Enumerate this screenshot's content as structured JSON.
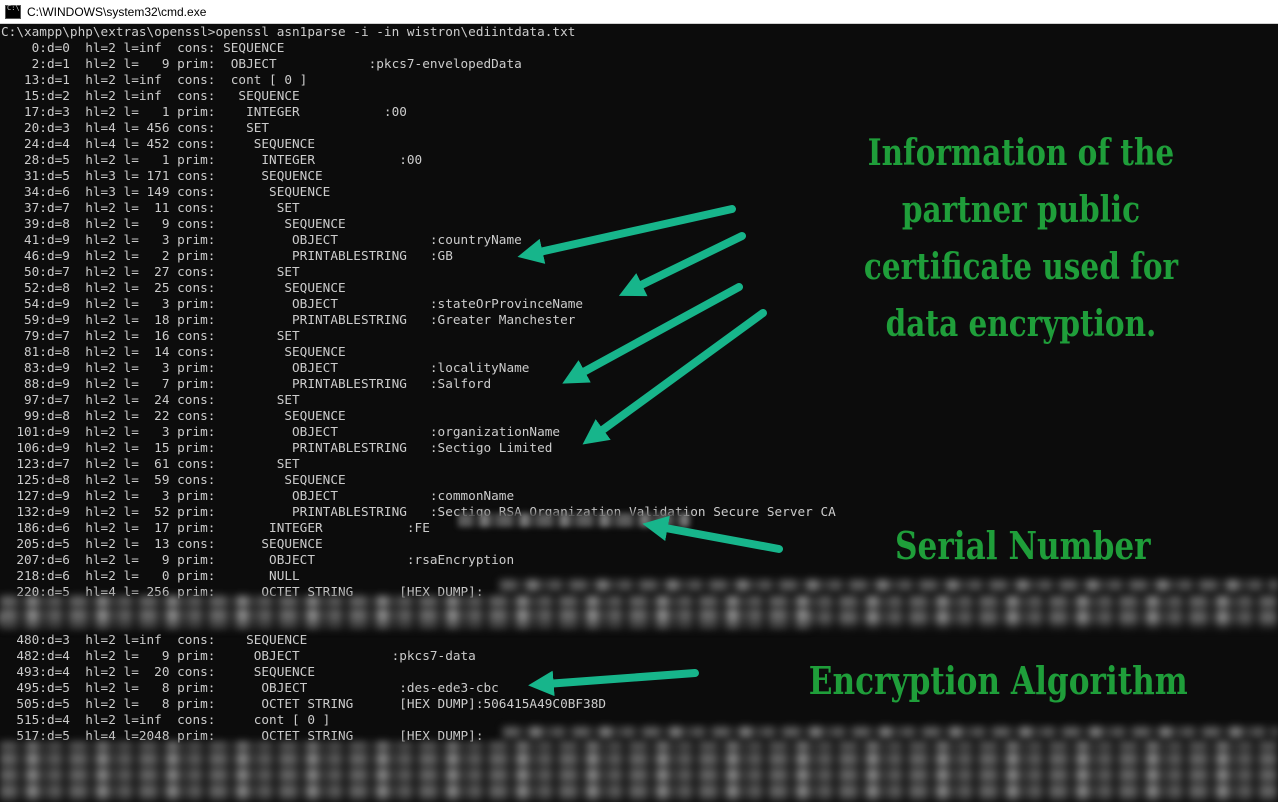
{
  "window": {
    "title": "C:\\WINDOWS\\system32\\cmd.exe",
    "icon": "console-icon"
  },
  "console": {
    "lines": [
      "C:\\xampp\\php\\extras\\openssl>openssl asn1parse -i -in wistron\\ediintdata.txt",
      "    0:d=0  hl=2 l=inf  cons: SEQUENCE",
      "    2:d=1  hl=2 l=   9 prim:  OBJECT            :pkcs7-envelopedData",
      "   13:d=1  hl=2 l=inf  cons:  cont [ 0 ]",
      "   15:d=2  hl=2 l=inf  cons:   SEQUENCE",
      "   17:d=3  hl=2 l=   1 prim:    INTEGER           :00",
      "   20:d=3  hl=4 l= 456 cons:    SET",
      "   24:d=4  hl=4 l= 452 cons:     SEQUENCE",
      "   28:d=5  hl=2 l=   1 prim:      INTEGER           :00",
      "   31:d=5  hl=3 l= 171 cons:      SEQUENCE",
      "   34:d=6  hl=3 l= 149 cons:       SEQUENCE",
      "   37:d=7  hl=2 l=  11 cons:        SET",
      "   39:d=8  hl=2 l=   9 cons:         SEQUENCE",
      "   41:d=9  hl=2 l=   3 prim:          OBJECT            :countryName",
      "   46:d=9  hl=2 l=   2 prim:          PRINTABLESTRING   :GB",
      "   50:d=7  hl=2 l=  27 cons:        SET",
      "   52:d=8  hl=2 l=  25 cons:         SEQUENCE",
      "   54:d=9  hl=2 l=   3 prim:          OBJECT            :stateOrProvinceName",
      "   59:d=9  hl=2 l=  18 prim:          PRINTABLESTRING   :Greater Manchester",
      "   79:d=7  hl=2 l=  16 cons:        SET",
      "   81:d=8  hl=2 l=  14 cons:         SEQUENCE",
      "   83:d=9  hl=2 l=   3 prim:          OBJECT            :localityName",
      "   88:d=9  hl=2 l=   7 prim:          PRINTABLESTRING   :Salford",
      "   97:d=7  hl=2 l=  24 cons:        SET",
      "   99:d=8  hl=2 l=  22 cons:         SEQUENCE",
      "  101:d=9  hl=2 l=   3 prim:          OBJECT            :organizationName",
      "  106:d=9  hl=2 l=  15 prim:          PRINTABLESTRING   :Sectigo Limited",
      "  123:d=7  hl=2 l=  61 cons:        SET",
      "  125:d=8  hl=2 l=  59 cons:         SEQUENCE",
      "  127:d=9  hl=2 l=   3 prim:          OBJECT            :commonName",
      "  132:d=9  hl=2 l=  52 prim:          PRINTABLESTRING   :Sectigo RSA Organization Validation Secure Server CA",
      "  186:d=6  hl=2 l=  17 prim:       INTEGER           :FE",
      "  205:d=5  hl=2 l=  13 cons:      SEQUENCE",
      "  207:d=6  hl=2 l=   9 prim:       OBJECT            :rsaEncryption",
      "  218:d=6  hl=2 l=   0 prim:       NULL",
      "  220:d=5  hl=4 l= 256 prim:      OCTET STRING      [HEX DUMP]:",
      "",
      "",
      "  480:d=3  hl=2 l=inf  cons:    SEQUENCE",
      "  482:d=4  hl=2 l=   9 prim:     OBJECT            :pkcs7-data",
      "  493:d=4  hl=2 l=  20 cons:     SEQUENCE",
      "  495:d=5  hl=2 l=   8 prim:      OBJECT            :des-ede3-cbc",
      "  505:d=5  hl=2 l=   8 prim:      OCTET STRING      [HEX DUMP]:506415A49C0BF38D",
      "  515:d=4  hl=2 l=inf  cons:     cont [ 0 ]",
      "  517:d=5  hl=4 l=2048 prim:      OCTET STRING      [HEX DUMP]:"
    ]
  },
  "annotations": {
    "certificate_info": "Information of the partner public certificate used for data encryption.",
    "serial_number": "Serial Number",
    "encryption_algorithm": "Encryption Algorithm"
  },
  "colors": {
    "console_background": "#0c0c0c",
    "console_text": "#cccccc",
    "annotation_text": "#1f9e3a",
    "arrow": "#17b58b"
  }
}
